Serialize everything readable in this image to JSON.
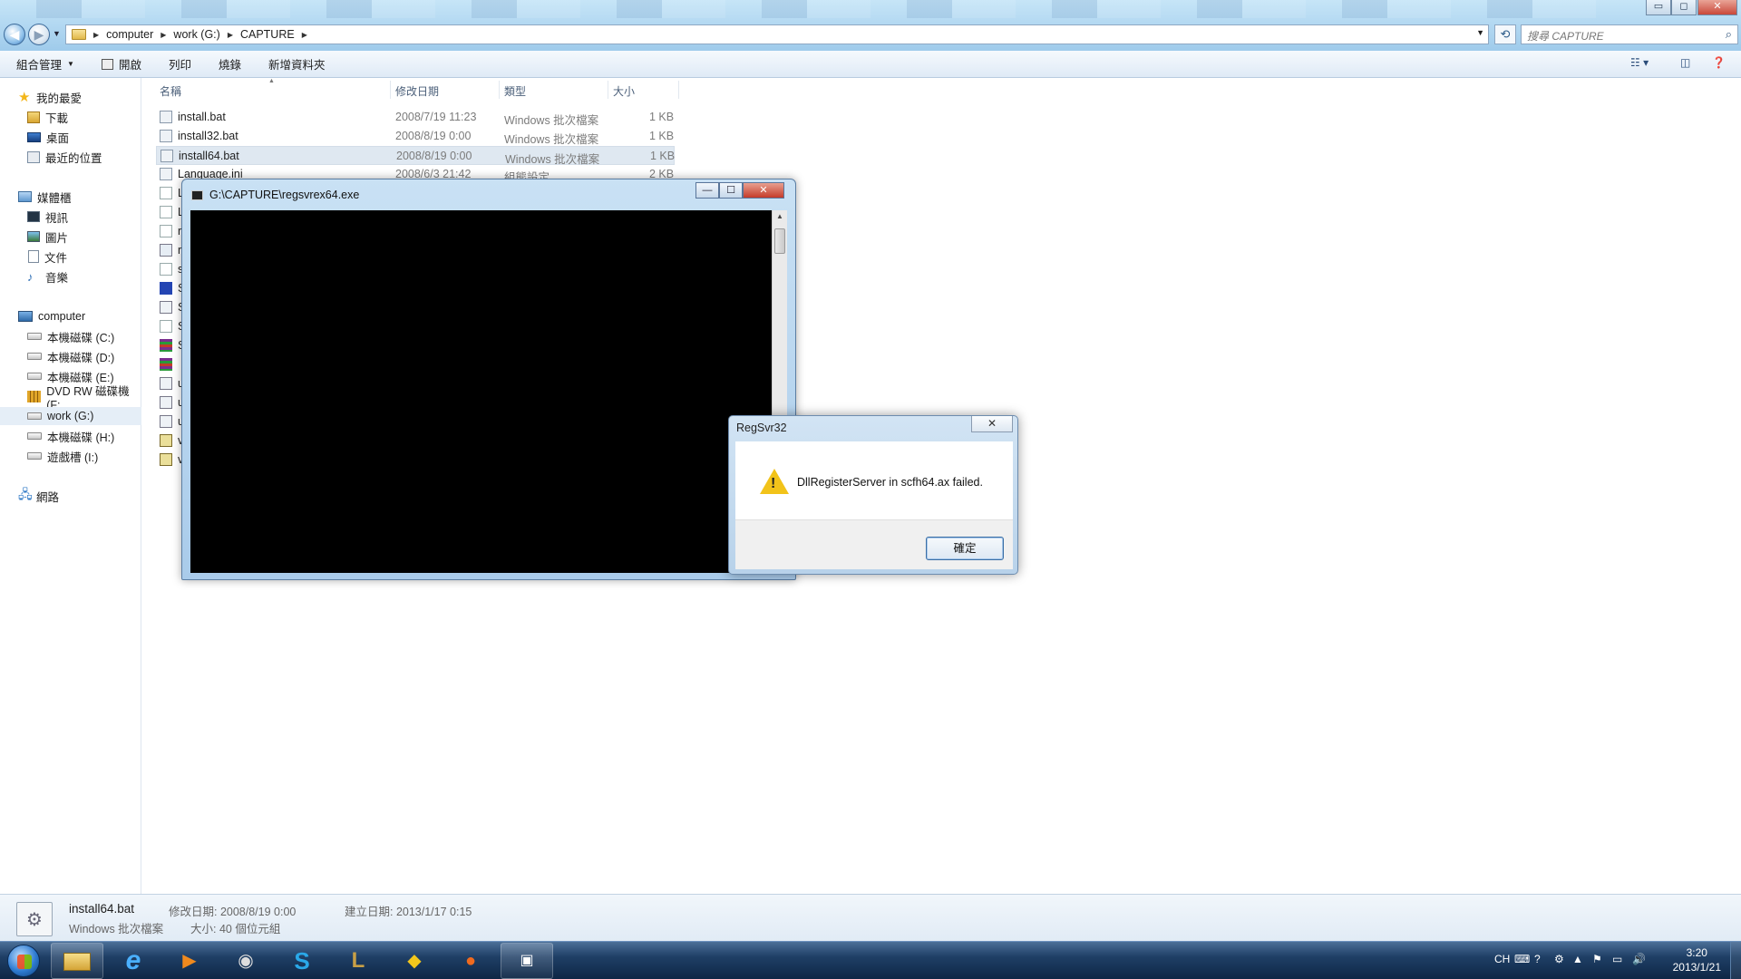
{
  "explorer": {
    "window_controls": {
      "minimize": "▭",
      "maximize": "◻",
      "close": "✕"
    },
    "breadcrumb": [
      "computer",
      "work (G:)",
      "CAPTURE"
    ],
    "search_placeholder": "搜尋 CAPTURE",
    "toolbar": {
      "organize": "組合管理",
      "open": "開啟",
      "print": "列印",
      "burn": "燒錄",
      "new_folder": "新增資料夾"
    },
    "nav": {
      "favorites": "我的最愛",
      "downloads": "下載",
      "desktop": "桌面",
      "recent": "最近的位置",
      "libraries": "媒體櫃",
      "videos": "視訊",
      "pictures": "圖片",
      "documents": "文件",
      "music": "音樂",
      "computer": "computer",
      "drive_c": "本機磁碟 (C:)",
      "drive_d": "本機磁碟 (D:)",
      "drive_e": "本機磁碟 (E:)",
      "drive_f": "DVD RW 磁碟機 (F:",
      "drive_g": "work (G:)",
      "drive_h": "本機磁碟 (H:)",
      "drive_i": "遊戲槽 (I:)",
      "network": "網路"
    },
    "columns": {
      "name": "名稱",
      "modified": "修改日期",
      "type": "類型",
      "size": "大小"
    },
    "files": [
      {
        "name": "install.bat",
        "modified": "2008/7/19 11:23",
        "type": "Windows 批次檔案",
        "size": "1 KB"
      },
      {
        "name": "install32.bat",
        "modified": "2008/8/19 0:00",
        "type": "Windows 批次檔案",
        "size": "1 KB"
      },
      {
        "name": "install64.bat",
        "modified": "2008/8/19 0:00",
        "type": "Windows 批次檔案",
        "size": "1 KB"
      },
      {
        "name": "Language.ini",
        "modified": "2008/6/3 21:42",
        "type": "組態設定",
        "size": "2 KB"
      }
    ],
    "partial_rows": [
      "L",
      "L",
      "r",
      "r",
      "s",
      "S",
      "S",
      "S",
      "S",
      "u",
      "u",
      "u",
      "v",
      "v"
    ],
    "details": {
      "name": "install64.bat",
      "type": "Windows 批次檔案",
      "modified": "修改日期: 2008/8/19 0:00",
      "created": "建立日期: 2013/1/17 0:15",
      "size": "大小: 40 個位元組"
    }
  },
  "console": {
    "title": "G:\\CAPTURE\\regsvrex64.exe",
    "controls": {
      "minimize": "—",
      "maximize": "☐",
      "close": "✕"
    }
  },
  "dialog": {
    "title": "RegSvr32",
    "close": "✕",
    "message": "DllRegisterServer in scfh64.ax failed.",
    "ok": "確定"
  },
  "taskbar": {
    "ie_glyph": "e",
    "skype_glyph": "S",
    "lol_glyph": "L",
    "lang": "CH",
    "time": "3:20",
    "date": "2013/1/21"
  }
}
